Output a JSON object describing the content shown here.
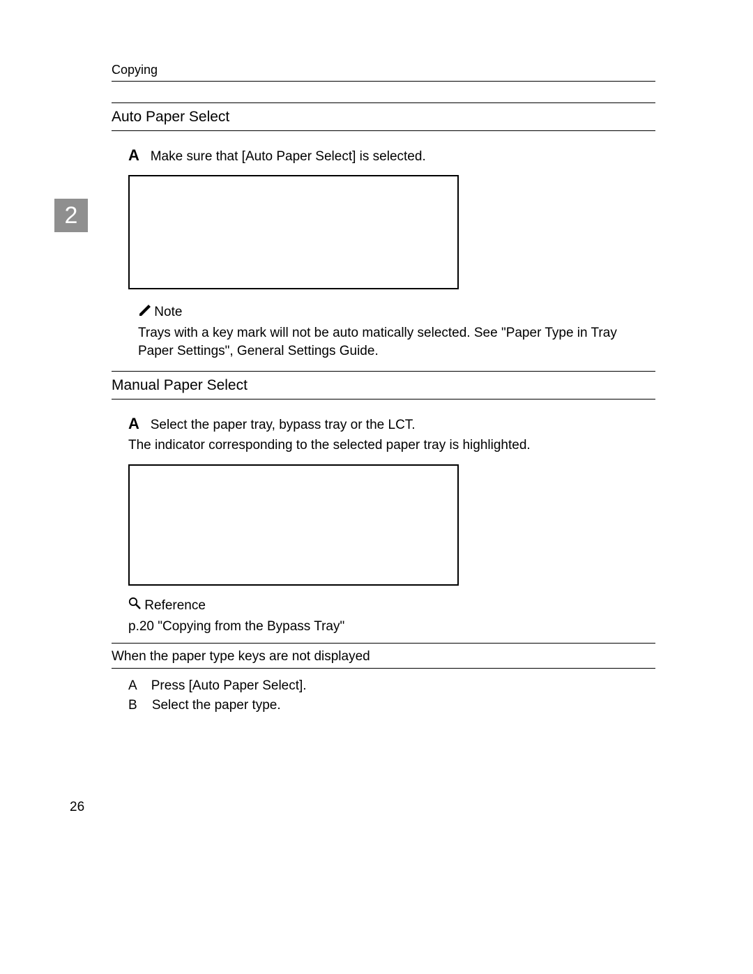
{
  "header": {
    "running_title": "Copying"
  },
  "chapter_tab": "2",
  "section1": {
    "heading": "Auto Paper Select",
    "step_letter": "A",
    "step_text": "Make sure that [Auto Paper Select] is selected.",
    "note_label": "Note",
    "note_body": "Trays with a key mark will not be auto matically selected. See \"Paper Type in Tray Paper Settings\", General Settings Guide."
  },
  "section2": {
    "heading": "Manual Paper Select",
    "step_letter": "A",
    "step_text": "Select the paper tray, bypass tray or the LCT.",
    "followup": "The indicator corresponding to the selected paper tray is highlighted.",
    "reference_label": "Reference",
    "reference_body": "p.20 \"Copying from the Bypass Tray\""
  },
  "section3": {
    "heading": "When the paper type keys are not displayed",
    "sub_a_label": "A",
    "sub_a_text": "Press [Auto Paper Select].",
    "sub_b_label": "B",
    "sub_b_text": "Select the paper type."
  },
  "page_number": "26"
}
